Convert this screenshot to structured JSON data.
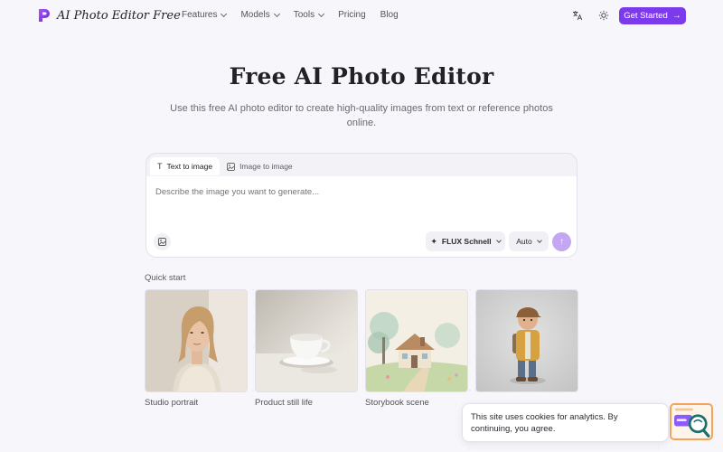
{
  "brand": {
    "name": "AI Photo Editor Free",
    "accent": "#7c3aed"
  },
  "nav": {
    "links": [
      {
        "label": "Features",
        "has_dropdown": true
      },
      {
        "label": "Models",
        "has_dropdown": true
      },
      {
        "label": "Tools",
        "has_dropdown": true
      },
      {
        "label": "Pricing",
        "has_dropdown": false
      },
      {
        "label": "Blog",
        "has_dropdown": false
      }
    ],
    "translate_icon": "translate-icon",
    "theme_icon": "sun-icon",
    "cta_label": "Get Started",
    "cta_icon": "arrow-right-icon"
  },
  "hero": {
    "title": "Free AI Photo Editor",
    "subtitle": "Use this free AI photo editor to create high-quality images from text or reference photos online."
  },
  "generator": {
    "tabs": [
      {
        "label": "Text to image",
        "icon": "text-icon",
        "active": true
      },
      {
        "label": "Image to image",
        "icon": "image-icon",
        "active": false
      }
    ],
    "prompt_placeholder": "Describe the image you want to generate...",
    "upload_icon": "image-add-icon",
    "model_label": "FLUX Schnell",
    "model_icon": "sparkle-icon",
    "ratio_label": "Auto",
    "send_icon": "arrow-up-icon"
  },
  "quick_start": {
    "label": "Quick start",
    "items": [
      {
        "caption": "Studio portrait"
      },
      {
        "caption": "Product still life"
      },
      {
        "caption": "Storybook scene"
      },
      {
        "caption": ""
      }
    ]
  },
  "cookie": {
    "text": "This site uses cookies for analytics. By continuing, you agree."
  },
  "support_widget": {
    "icon": "chat-search-icon",
    "accent": "#f3a35a"
  }
}
